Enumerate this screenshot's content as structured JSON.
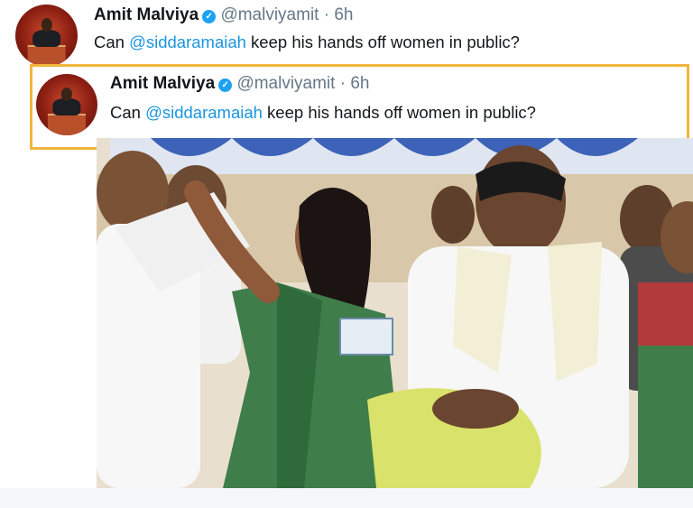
{
  "outer_tweet": {
    "author_name": "Amit Malviya",
    "verified_badge": "✓",
    "handle": "@malviyamit",
    "separator": "·",
    "time": "6h",
    "text_before": "Can ",
    "mention": "@siddaramaiah",
    "text_after": " keep his hands off women in public?"
  },
  "quoted_tweet": {
    "author_name": "Amit Malviya",
    "verified_badge": "✓",
    "handle": "@malviyamit",
    "separator": "·",
    "time": "6h",
    "text_before": "Can ",
    "mention": "@siddaramaiah",
    "text_after": " keep his hands off women in public?",
    "highlight_color": "#f3b53c"
  },
  "colors": {
    "mention": "#1b95e0",
    "verified": "#1da1f2",
    "muted": "#657786"
  }
}
